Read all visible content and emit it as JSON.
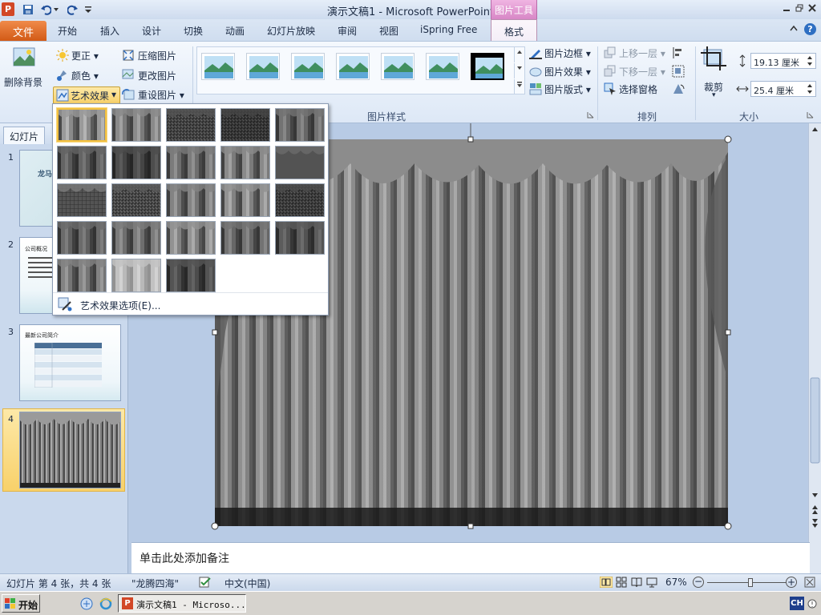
{
  "window": {
    "title": "演示文稿1  -  Microsoft PowerPoint",
    "contextual_tab_header": "图片工具",
    "app_icon_letter": "P"
  },
  "tabs": {
    "file": "文件",
    "items": [
      "开始",
      "插入",
      "设计",
      "切换",
      "动画",
      "幻灯片放映",
      "审阅",
      "视图",
      "iSpring Free"
    ],
    "active": "格式"
  },
  "ribbon": {
    "remove_bg": "删除背景",
    "corrections": "更正",
    "color": "颜色",
    "artistic_effects": "艺术效果",
    "compress": "压缩图片",
    "change_picture": "更改图片",
    "reset_picture": "重设图片",
    "picture_border": "图片边框",
    "picture_effects": "图片效果",
    "picture_layout": "图片版式",
    "bring_forward": "上移一层",
    "send_backward": "下移一层",
    "selection_pane": "选择窗格",
    "crop": "裁剪",
    "height_value": "19.13 厘米",
    "width_value": "25.4 厘米",
    "groups": {
      "picture_styles": "图片样式",
      "arrange": "排列",
      "size": "大小"
    }
  },
  "left_pane": {
    "tab_label": "幻灯片",
    "slides": [
      {
        "number": "1",
        "thumb_text": "龙马"
      },
      {
        "number": "2",
        "thumb_text": "公司概况"
      },
      {
        "number": "3",
        "thumb_text": "最新公司简介"
      },
      {
        "number": "4",
        "thumb_text": ""
      }
    ]
  },
  "notes": {
    "placeholder": "单击此处添加备注"
  },
  "dropdown": {
    "options_label": "艺术效果选项(E)..."
  },
  "status": {
    "slide_info": "幻灯片 第 4 张，共 4 张",
    "theme": "\"龙腾四海\"",
    "language": "中文(中国)",
    "zoom": "67%",
    "zoom_level_fraction": 0.55
  },
  "taskbar": {
    "start": "开始",
    "window_button": "演示文稿1 - Microso...",
    "ime": "CH"
  },
  "colors": {
    "file_tab": "#d25a16",
    "contextual_pink": "#d887c6",
    "selection_yellow": "#f2c041",
    "ribbon_bg": "#dde8f6"
  },
  "icons": {
    "save": "save-icon",
    "undo": "undo-icon",
    "redo": "redo-icon",
    "help": "help-icon",
    "minimize": "minimize-icon",
    "restore": "restore-icon",
    "close": "close-icon"
  }
}
